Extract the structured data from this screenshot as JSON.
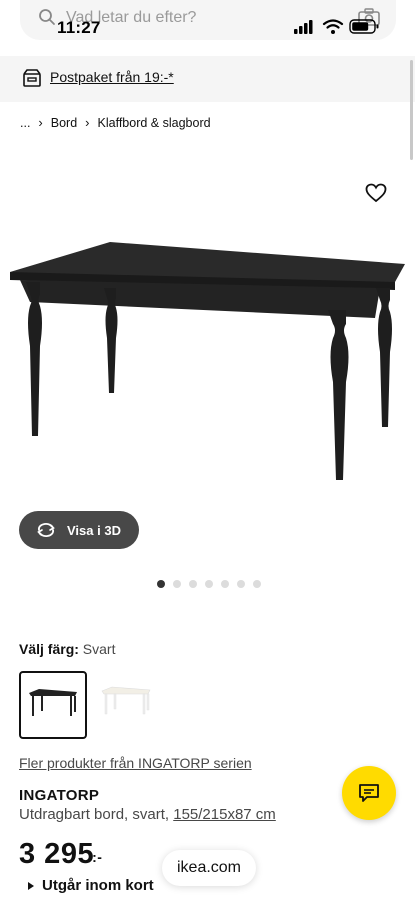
{
  "status_bar": {
    "time": "11:27"
  },
  "search": {
    "placeholder": "Vad letar du efter?"
  },
  "promo": {
    "text": "Postpaket från 19:-*"
  },
  "breadcrumb": {
    "ellipsis": "...",
    "items": [
      "Bord",
      "Klaffbord & slagbord"
    ]
  },
  "gallery": {
    "view_3d_label": "Visa i 3D",
    "image_count": 7,
    "active_index": 0
  },
  "color": {
    "label": "Välj färg:",
    "value": "Svart",
    "options": [
      "black",
      "white"
    ]
  },
  "product": {
    "series_link": "Fler produkter från INGATORP serien",
    "name": "INGATORP",
    "description": "Utdragbart bord, svart, ",
    "dimensions": "155/215x87 cm",
    "price": "3 295",
    "price_suffix": ":-",
    "stock_text": "Utgår inom kort"
  },
  "browser": {
    "url": "ikea.com"
  },
  "colors": {
    "chat_button": "#ffdb00",
    "table_black": "#222222"
  }
}
